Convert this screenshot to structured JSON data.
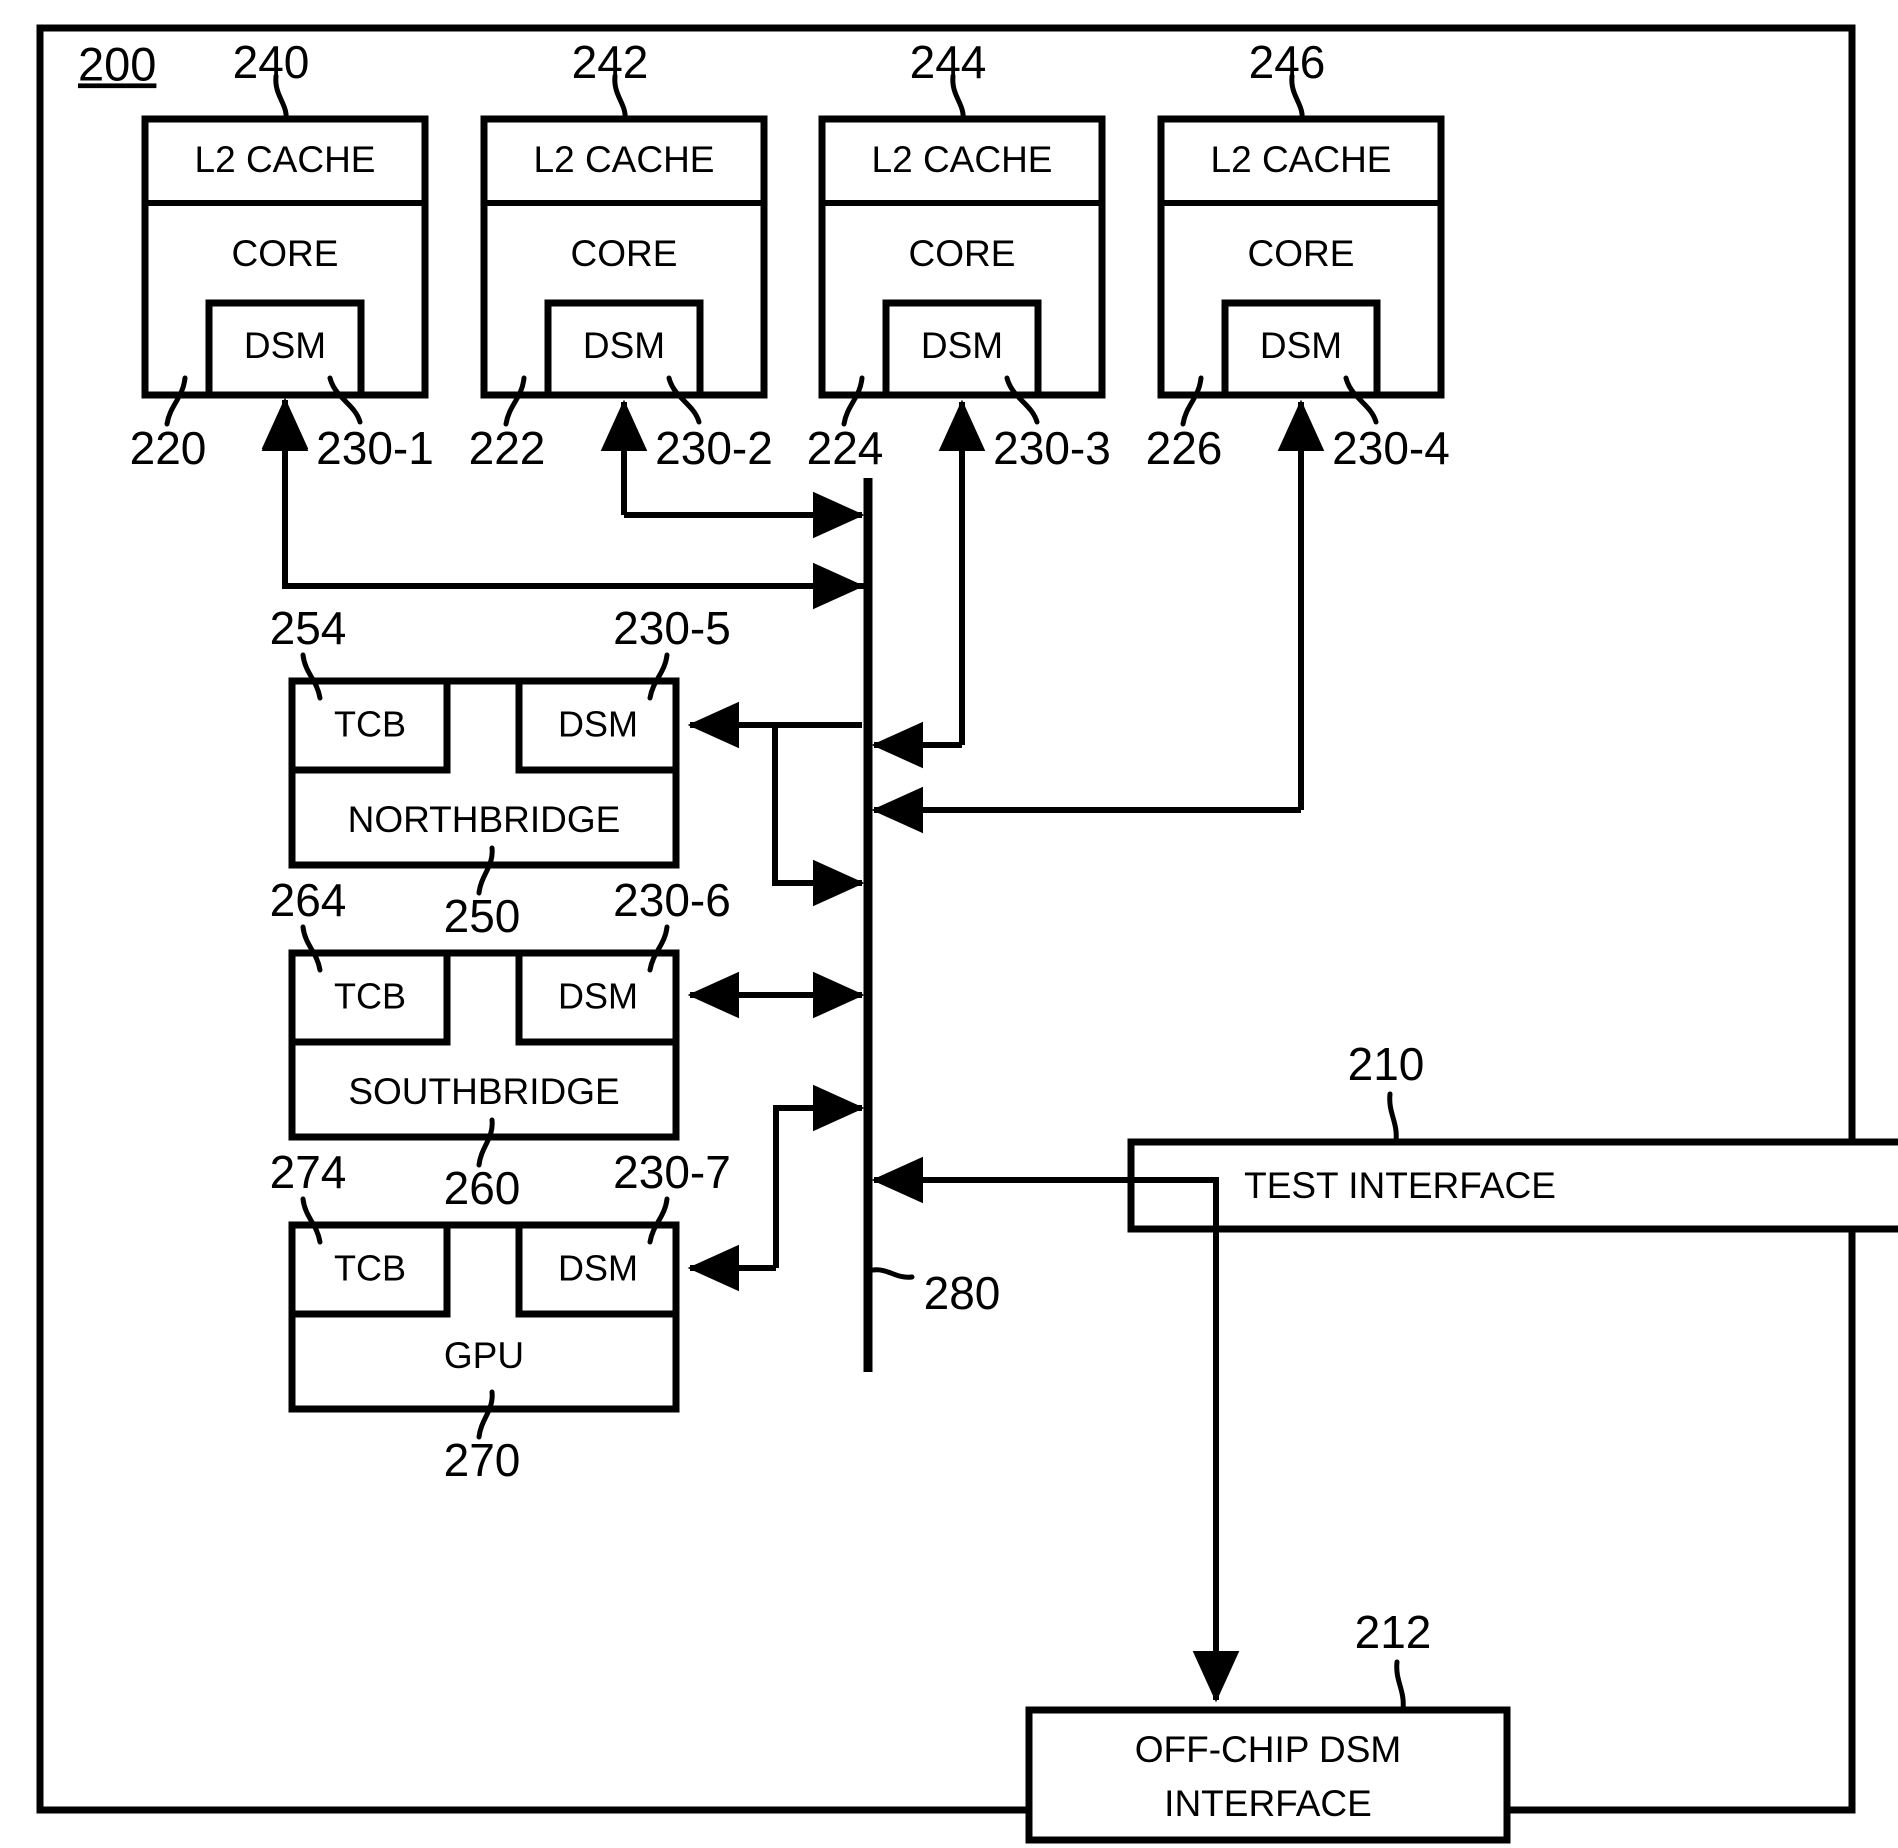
{
  "figure": {
    "number": "200",
    "outer_border": true
  },
  "cores": [
    {
      "cache_label": "L2 CACHE",
      "core_label": "CORE",
      "dsm_label": "DSM",
      "cache_ref": "240",
      "core_ref": "220",
      "dsm_ref": "230-1"
    },
    {
      "cache_label": "L2 CACHE",
      "core_label": "CORE",
      "dsm_label": "DSM",
      "cache_ref": "242",
      "core_ref": "222",
      "dsm_ref": "230-2"
    },
    {
      "cache_label": "L2 CACHE",
      "core_label": "CORE",
      "dsm_label": "DSM",
      "cache_ref": "244",
      "core_ref": "224",
      "dsm_ref": "230-3"
    },
    {
      "cache_label": "L2 CACHE",
      "core_label": "CORE",
      "dsm_label": "DSM",
      "cache_ref": "246",
      "core_ref": "226",
      "dsm_ref": "230-4"
    }
  ],
  "bridges": [
    {
      "name": "NORTHBRIDGE",
      "tcb_label": "TCB",
      "dsm_label": "DSM",
      "tcb_ref": "254",
      "dsm_ref": "230-5",
      "body_ref": "250"
    },
    {
      "name": "SOUTHBRIDGE",
      "tcb_label": "TCB",
      "dsm_label": "DSM",
      "tcb_ref": "264",
      "dsm_ref": "230-6",
      "body_ref": "260"
    },
    {
      "name": "GPU",
      "tcb_label": "TCB",
      "dsm_label": "DSM",
      "tcb_ref": "274",
      "dsm_ref": "230-7",
      "body_ref": "270"
    }
  ],
  "interfaces": {
    "test_interface": {
      "label": "TEST INTERFACE",
      "ref": "210"
    },
    "off_chip_dsm": {
      "label_line1": "OFF-CHIP DSM",
      "label_line2": "INTERFACE",
      "ref": "212"
    }
  },
  "bus": {
    "ref": "280"
  },
  "colors": {
    "stroke": "#000000",
    "background": "#ffffff"
  }
}
